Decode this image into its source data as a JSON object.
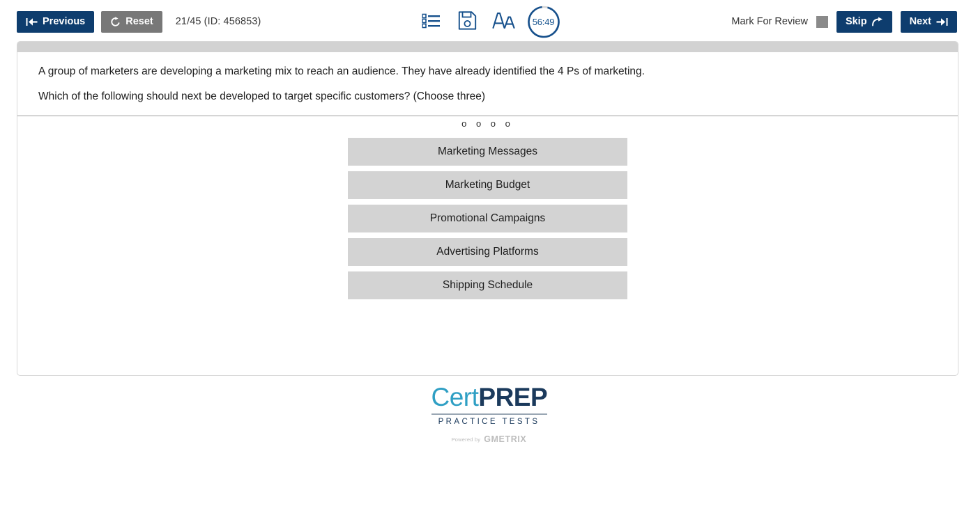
{
  "toolbar": {
    "previous_label": "Previous",
    "previous_icon": "skip-to-start-arrow-icon",
    "reset_label": "Reset",
    "reset_icon": "refresh-icon",
    "question_counter": "21/45 (ID: 456853)",
    "list_icon": "question-list-icon",
    "save_icon": "save-floppy-icon",
    "font_size_icon": "font-size-AA-icon",
    "timer_value": "56:49",
    "mark_for_review_label": "Mark For Review",
    "mark_for_review_checked": false,
    "skip_label": "Skip",
    "skip_icon": "skip-forward-arrow-icon",
    "next_label": "Next",
    "next_icon": "skip-to-end-arrow-icon"
  },
  "question": {
    "paragraphs": [
      "A group of marketers are developing a marketing mix to reach an audience. They have already identified the 4 Ps of marketing.",
      "Which of the following should next be developed to target specific customers? (Choose three)"
    ],
    "drop_markers": "o o o o",
    "options": [
      {
        "label": "Marketing Messages"
      },
      {
        "label": "Marketing Budget"
      },
      {
        "label": "Promotional Campaigns"
      },
      {
        "label": "Advertising Platforms"
      },
      {
        "label": "Shipping Schedule"
      }
    ]
  },
  "footer": {
    "logo_cert": "Cert",
    "logo_prep": "PREP",
    "logo_tagline": "PRACTICE TESTS",
    "powered_by": "Powered by",
    "powered_brand": "GMETRIX"
  },
  "colors": {
    "navy": "#0e3d6e",
    "gray_button": "#787878",
    "option_gray": "#d3d3d3",
    "panel_topbar": "#d2d2d2",
    "timer_blue": "#17548f",
    "logo_cert_blue": "#2f9fc4",
    "logo_prep_navy": "#1b3a5c"
  }
}
